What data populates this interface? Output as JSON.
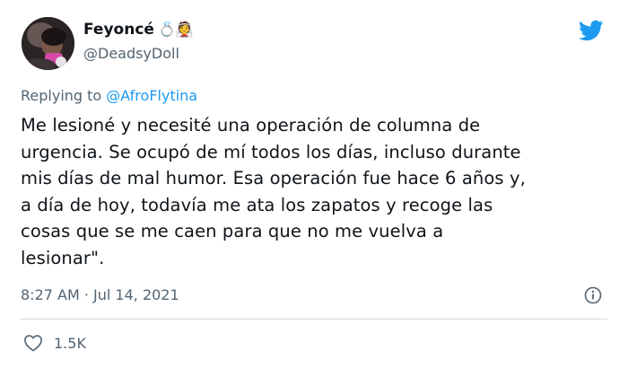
{
  "author": {
    "display_name": "Feyoncé",
    "name_emojis": "💍👰",
    "handle": "@DeadsyDoll"
  },
  "reply": {
    "prefix": "Replying to",
    "target": "@AfroFlytina"
  },
  "tweet": {
    "text_lines": [
      "Me lesioné y necesité una operación de columna de",
      "urgencia. Se ocupó de mí todos los días, incluso durante",
      "mis días de mal humor. Esa operación fue hace 6 años y,",
      "a día de hoy, todavía me ata los zapatos y recoge las",
      "cosas que se me caen para que no me vuelva a",
      "lesionar\"."
    ],
    "timestamp": "8:27 AM · Jul 14, 2021",
    "likes": "1.5K"
  },
  "icons": {
    "logo": "twitter-bird-icon",
    "info": "info-icon",
    "like": "heart-icon"
  },
  "colors": {
    "brand": "#1d9bf0",
    "muted": "#536471",
    "text": "#0f1419"
  }
}
